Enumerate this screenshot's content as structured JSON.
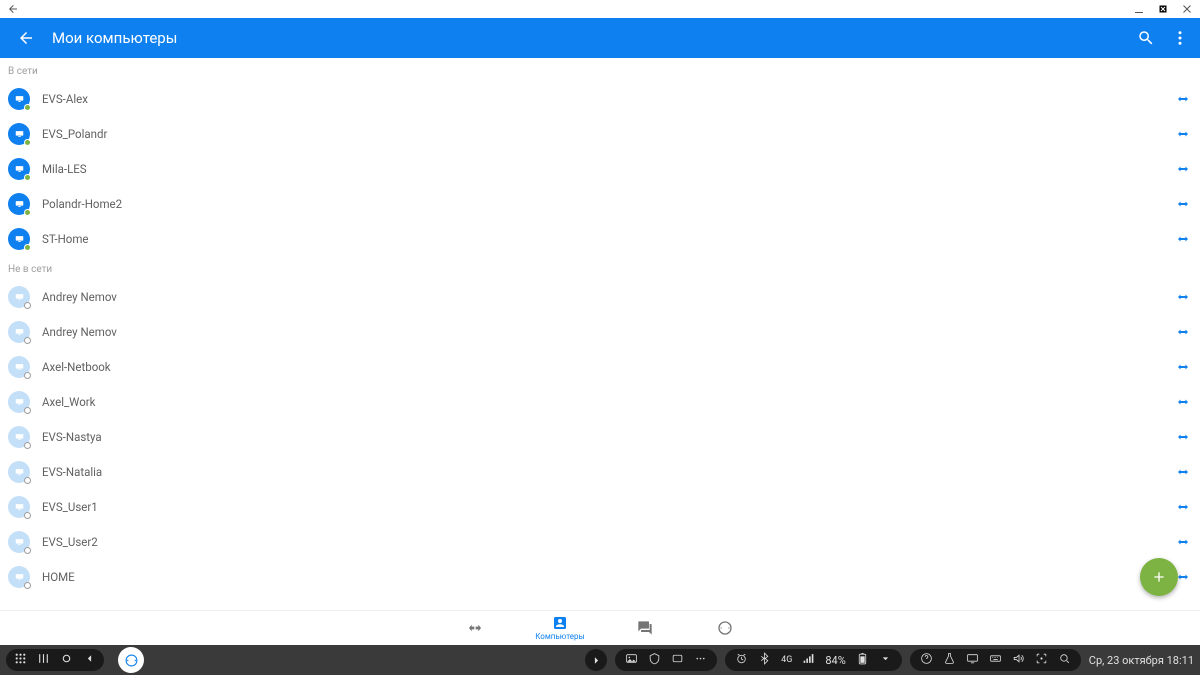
{
  "header": {
    "title": "Мои компьютеры"
  },
  "sections": {
    "online": {
      "title": "В сети",
      "items": [
        "EVS-Alex",
        "EVS_Polandr",
        "Mila-LES",
        "Polandr-Home2",
        "ST-Home"
      ]
    },
    "offline": {
      "title": "Не в сети",
      "items": [
        "Andrey Nemov",
        "Andrey Nemov",
        "Axel-Netbook",
        "Axel_Work",
        "EVS-Nastya",
        "EVS-Natalia",
        "EVS_User1",
        "EVS_User2",
        "HOME"
      ]
    }
  },
  "bottom_nav": {
    "computers": "Компьютеры"
  },
  "taskbar": {
    "battery": "84%",
    "datetime": "Ср, 23 октября 18:11",
    "signal_label": "4G"
  }
}
